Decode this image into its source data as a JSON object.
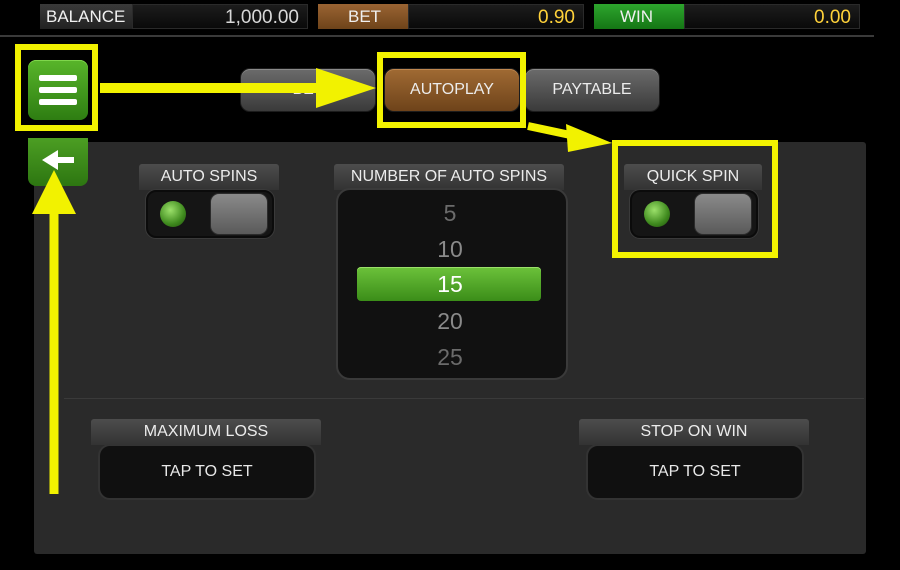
{
  "status_bar": {
    "balance_label": "BALANCE",
    "balance_value": "1,000.00",
    "bet_label": "BET",
    "bet_value": "0.90",
    "win_label": "WIN",
    "win_value": "0.00"
  },
  "tabs": [
    {
      "label": "BET"
    },
    {
      "label": "AUTOPLAY",
      "active": true
    },
    {
      "label": "PAYTABLE"
    }
  ],
  "auto_spins": {
    "label": "AUTO SPINS",
    "enabled": false
  },
  "number_of_auto_spins": {
    "label": "NUMBER OF AUTO SPINS",
    "options": [
      "5",
      "10",
      "15",
      "20",
      "25"
    ],
    "selected": "15"
  },
  "quick_spin": {
    "label": "QUICK SPIN",
    "enabled": false
  },
  "maximum_loss": {
    "label": "MAXIMUM LOSS",
    "button": "TAP TO SET"
  },
  "stop_on_win": {
    "label": "STOP ON WIN",
    "button": "TAP TO SET"
  },
  "colors": {
    "accent_green": "#4aa520",
    "active_tab": "#8a5628",
    "highlight_yellow": "#f2f200",
    "bet_label_bg": "#8a5628",
    "win_label_bg": "#1f8a1f"
  }
}
